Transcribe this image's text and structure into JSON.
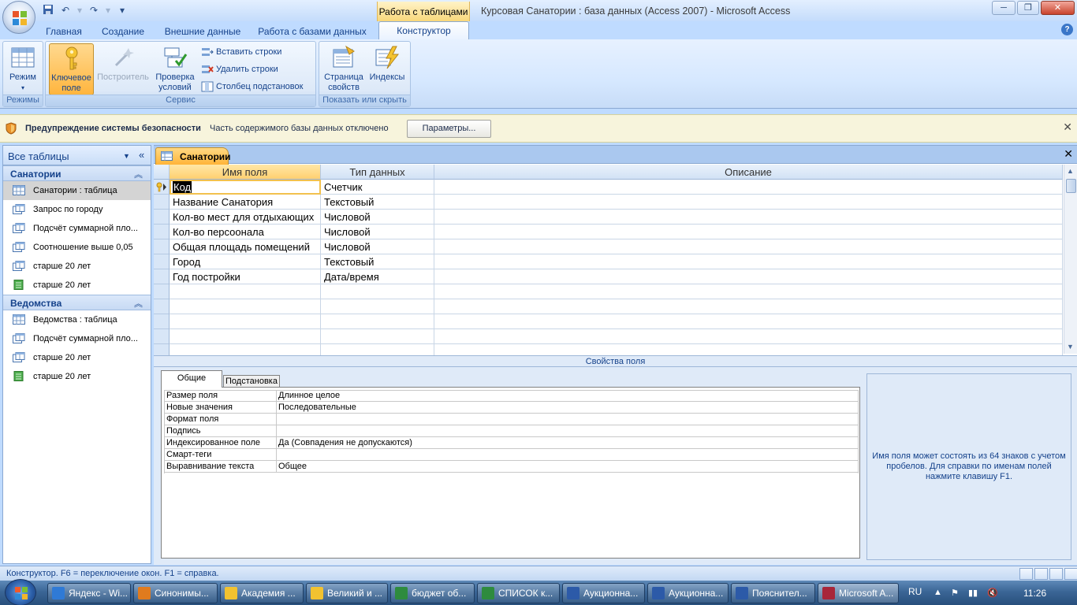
{
  "title_bar": {
    "context_tab": "Работа с таблицами",
    "window_title": "Курсовая Санатории : база данных (Access 2007) - Microsoft Access",
    "minimize": "─",
    "maximize": "❐",
    "close": "✕"
  },
  "tabs": [
    {
      "label": "Главная"
    },
    {
      "label": "Создание"
    },
    {
      "label": "Внешние данные"
    },
    {
      "label": "Работа с базами данных"
    },
    {
      "label": "Конструктор"
    }
  ],
  "ribbon": {
    "groups": {
      "modes": "Режимы",
      "service": "Сервис",
      "show_hide": "Показать или скрыть"
    },
    "view_btn": "Режим",
    "key_btn_1": "Ключевое",
    "key_btn_2": "поле",
    "builder_btn": "Построитель",
    "check_btn_1": "Проверка",
    "check_btn_2": "условий",
    "insert_rows": "Вставить строки",
    "delete_rows": "Удалить строки",
    "lookup_col": "Столбец подстановок",
    "prop_sheet_1": "Страница",
    "prop_sheet_2": "свойств",
    "indexes": "Индексы"
  },
  "security_bar": {
    "title": "Предупреждение системы безопасности",
    "message": "Часть содержимого базы данных отключено",
    "button": "Параметры..."
  },
  "nav": {
    "header": "Все таблицы",
    "groups": [
      {
        "label": "Санатории",
        "items": [
          {
            "label": "Санатории : таблица",
            "icon": "table-icon"
          },
          {
            "label": "Запрос по городу",
            "icon": "query-icon"
          },
          {
            "label": "Подсчёт суммарной пло...",
            "icon": "query-icon"
          },
          {
            "label": "Соотношение выше 0,05",
            "icon": "query-icon"
          },
          {
            "label": "старше 20 лет",
            "icon": "query-icon"
          },
          {
            "label": "старше 20 лет",
            "icon": "report-icon"
          }
        ]
      },
      {
        "label": "Ведомства",
        "items": [
          {
            "label": "Ведомства : таблица",
            "icon": "table-icon"
          },
          {
            "label": "Подсчёт суммарной пло...",
            "icon": "query-icon"
          },
          {
            "label": "старше 20 лет",
            "icon": "query-icon"
          },
          {
            "label": "старше 20 лет",
            "icon": "report-icon"
          }
        ]
      }
    ]
  },
  "document": {
    "tab_label": "Санатории",
    "columns": [
      "Имя поля",
      "Тип данных",
      "Описание"
    ],
    "rows": [
      {
        "name": "Код",
        "type": "Счетчик",
        "desc": ""
      },
      {
        "name": "Название Санатория",
        "type": "Текстовый",
        "desc": ""
      },
      {
        "name": "Кол-во мест для отдыхающих",
        "type": "Числовой",
        "desc": ""
      },
      {
        "name": "Кол-во персоонала",
        "type": "Числовой",
        "desc": ""
      },
      {
        "name": "Общая площадь помещений",
        "type": "Числовой",
        "desc": ""
      },
      {
        "name": "Город",
        "type": "Текстовый",
        "desc": ""
      },
      {
        "name": "Год постройки",
        "type": "Дата/время",
        "desc": ""
      }
    ]
  },
  "field_properties": {
    "title": "Свойства поля",
    "tabs": [
      "Общие",
      "Подстановка"
    ],
    "rows": [
      {
        "k": "Размер поля",
        "v": "Длинное целое"
      },
      {
        "k": "Новые значения",
        "v": "Последовательные"
      },
      {
        "k": "Формат поля",
        "v": ""
      },
      {
        "k": "Подпись",
        "v": ""
      },
      {
        "k": "Индексированное поле",
        "v": "Да (Совпадения не допускаются)"
      },
      {
        "k": "Смарт-теги",
        "v": ""
      },
      {
        "k": "Выравнивание текста",
        "v": "Общее"
      }
    ],
    "help": "Имя поля может состоять из 64 знаков с учетом пробелов.  Для справки по именам полей нажмите клавишу F1."
  },
  "status_bar": {
    "text": "Конструктор.  F6 = переключение окон.  F1 = справка."
  },
  "taskbar": {
    "items": [
      {
        "label": "Яндекс - Wi...",
        "icon_color": "#2f7ad6"
      },
      {
        "label": "Синонимы...",
        "icon_color": "#e07b1e"
      },
      {
        "label": "Академия ...",
        "icon_color": "#f2c230"
      },
      {
        "label": "Великий и ...",
        "icon_color": "#f2c230"
      },
      {
        "label": "бюджет об...",
        "icon_color": "#2e8b3e"
      },
      {
        "label": "СПИСОК к...",
        "icon_color": "#2e8b3e"
      },
      {
        "label": "Аукционна...",
        "icon_color": "#2c5aa8"
      },
      {
        "label": "Аукционна...",
        "icon_color": "#2c5aa8"
      },
      {
        "label": "Пояснител...",
        "icon_color": "#2c5aa8"
      },
      {
        "label": "Microsoft A...",
        "icon_color": "#a8263a"
      }
    ],
    "lang": "RU",
    "clock": "11:26"
  }
}
